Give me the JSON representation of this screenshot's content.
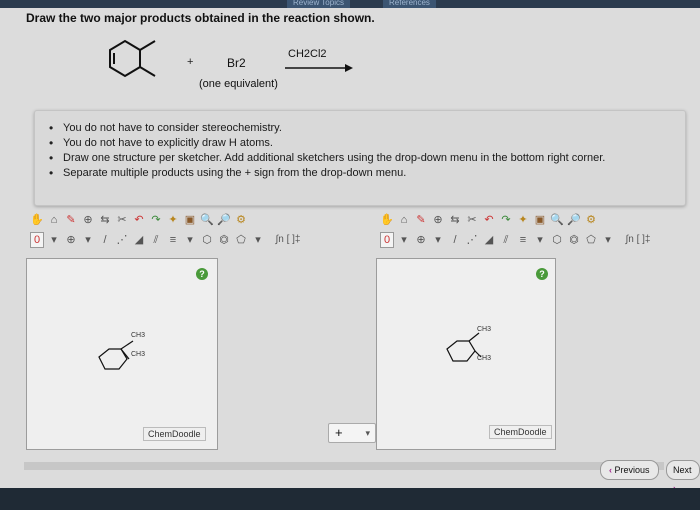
{
  "header": {
    "tabs": [
      {
        "label": "Review Topics"
      },
      {
        "label": "References"
      }
    ]
  },
  "question": {
    "prompt": "Draw the two major products obtained in the reaction shown."
  },
  "reaction": {
    "plus": "+",
    "reagent": "Br2",
    "equivalent": "(one equivalent)",
    "solvent": "CH2Cl2"
  },
  "instructions": [
    "You do not have to consider stereochemistry.",
    "You do not have to explicitly draw H atoms.",
    "Draw one structure per sketcher. Add additional sketchers using the drop-down menu in the bottom right corner.",
    "Separate multiple products using the + sign from the drop-down menu."
  ],
  "sketchers": [
    {
      "help": "?",
      "brand": "ChemDoodle",
      "label_ch3_top": "CH3",
      "label_ch3_bottom": "CH3"
    },
    {
      "help": "?",
      "brand": "ChemDoodle",
      "label_ch3_top": "CH3",
      "label_ch3_bottom": "CH3"
    }
  ],
  "toolbar": {
    "charge_label": "0",
    "template_labels": "∫n [ ]‡"
  },
  "add_sketcher": {
    "label": "+"
  },
  "navigation": {
    "previous": "Previous",
    "next": "Next"
  }
}
